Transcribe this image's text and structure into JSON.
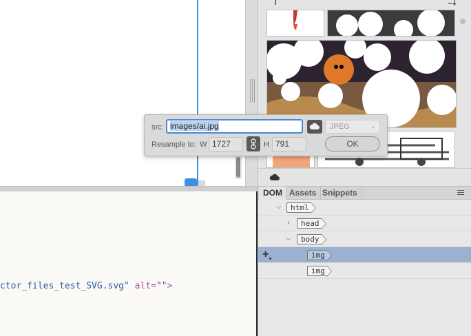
{
  "design_view": {},
  "code_view": {
    "line_fragment": "ctor_files_test_SVG.svg\"",
    "attr_name": " alt=",
    "attr_value": "\"\"",
    "tag_close": ">"
  },
  "right_panel": {
    "tabs": [
      {
        "label": "DOM",
        "active": true
      },
      {
        "label": "Assets",
        "active": false
      },
      {
        "label": "Snippets",
        "active": false
      }
    ],
    "dom_tree": [
      {
        "tag": "html",
        "expanded": true,
        "depth": 1,
        "selected": false
      },
      {
        "tag": "head",
        "expanded": false,
        "depth": 2,
        "selected": false
      },
      {
        "tag": "body",
        "expanded": true,
        "depth": 2,
        "selected": false
      },
      {
        "tag": "img",
        "expanded": null,
        "depth": 3,
        "selected": true
      },
      {
        "tag": "img",
        "expanded": null,
        "depth": 3,
        "selected": false
      }
    ]
  },
  "popup": {
    "src_label": "src:",
    "src_value": "images/ai.jpg",
    "format_value": "JPEG",
    "resample_label": "Resample to:",
    "w_label": "W",
    "w_value": "1727",
    "h_label": "H",
    "h_value": "791",
    "ok_label": "OK"
  },
  "icons": {
    "cloud": "cloud-icon",
    "link": "link-icon",
    "chevron": "chevron-down-icon",
    "add": "add-element-icon",
    "menu": "panel-menu-icon"
  },
  "colors": {
    "accent": "#4a8ad8",
    "selection": "#9ab1cf",
    "guide": "#3d8fe0"
  }
}
